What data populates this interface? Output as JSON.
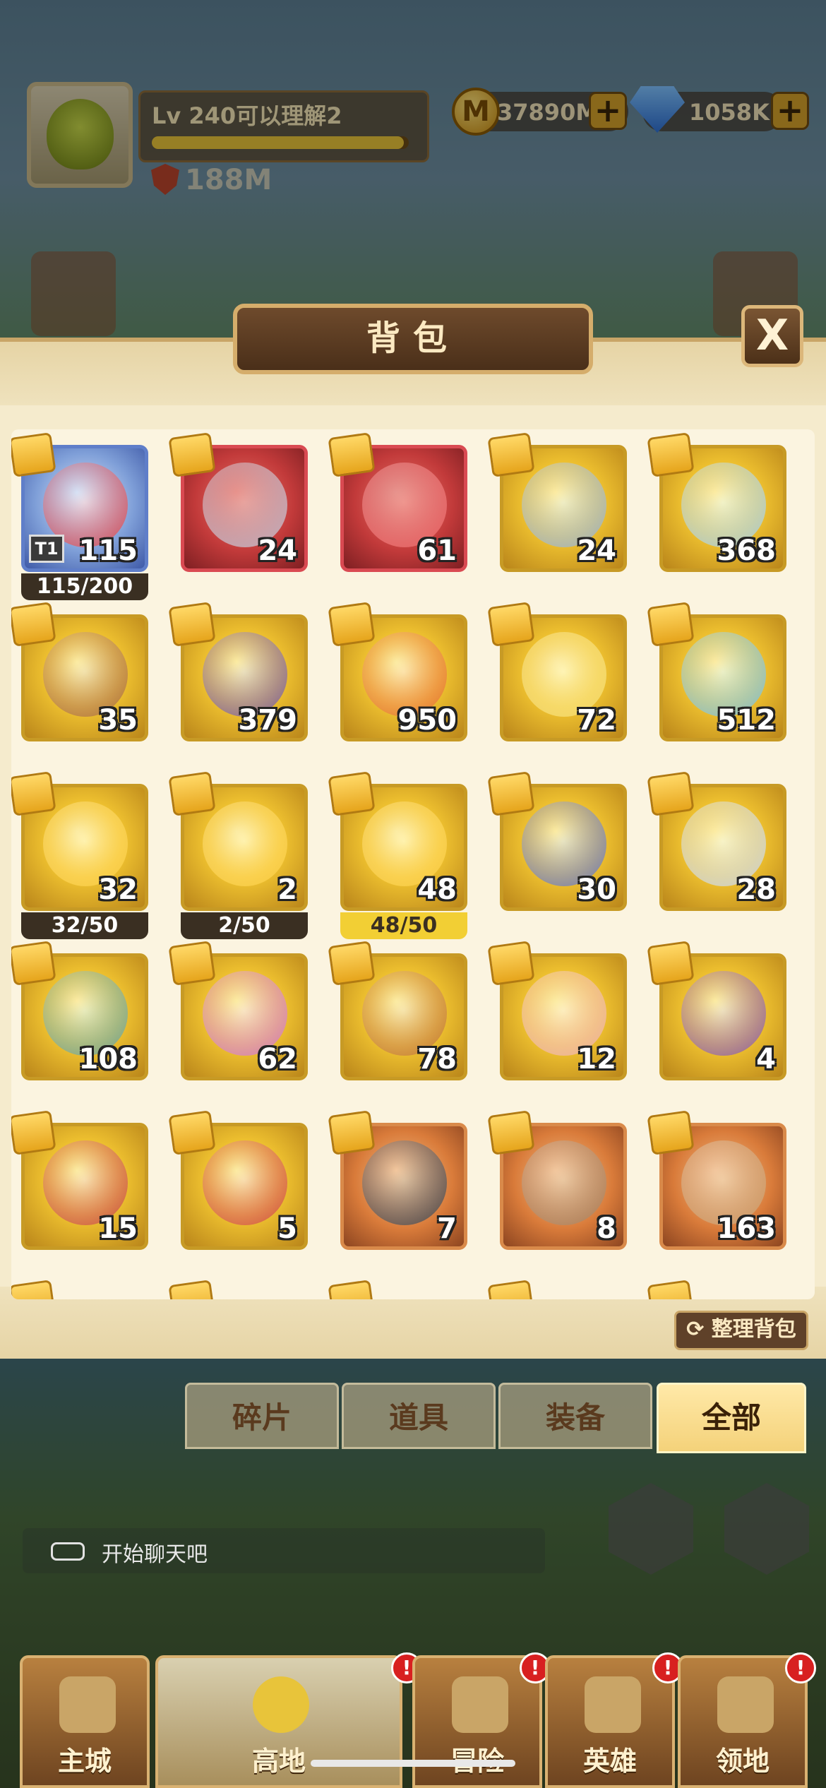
{
  "hud": {
    "player_name": "Lv 240可以理解2",
    "xp_fraction": 0.98,
    "power": "188M",
    "coin_symbol": "M",
    "coins": "37890M",
    "gems": "1058K",
    "plus": "+"
  },
  "panel": {
    "title": "背包",
    "close": "X",
    "sort_button": "整理背包"
  },
  "items": [
    {
      "count": "115",
      "frame": "blue",
      "tier": "T1",
      "progress": "115/200",
      "progress_style": "dark"
    },
    {
      "count": "24",
      "frame": "red"
    },
    {
      "count": "61",
      "frame": "red"
    },
    {
      "count": "24",
      "frame": "gold"
    },
    {
      "count": "368",
      "frame": "gold"
    },
    {
      "count": "35",
      "frame": "gold"
    },
    {
      "count": "379",
      "frame": "gold"
    },
    {
      "count": "950",
      "frame": "gold"
    },
    {
      "count": "72",
      "frame": "gold"
    },
    {
      "count": "512",
      "frame": "gold"
    },
    {
      "count": "32",
      "frame": "gold",
      "progress": "32/50",
      "progress_style": "dark"
    },
    {
      "count": "2",
      "frame": "gold",
      "progress": "2/50",
      "progress_style": "dark"
    },
    {
      "count": "48",
      "frame": "gold",
      "progress": "48/50",
      "progress_style": "yellow"
    },
    {
      "count": "30",
      "frame": "gold"
    },
    {
      "count": "28",
      "frame": "gold"
    },
    {
      "count": "108",
      "frame": "gold"
    },
    {
      "count": "62",
      "frame": "gold"
    },
    {
      "count": "78",
      "frame": "gold"
    },
    {
      "count": "12",
      "frame": "gold"
    },
    {
      "count": "4",
      "frame": "gold"
    },
    {
      "count": "15",
      "frame": "gold"
    },
    {
      "count": "5",
      "frame": "gold"
    },
    {
      "count": "7",
      "frame": "orange"
    },
    {
      "count": "8",
      "frame": "orange"
    },
    {
      "count": "163",
      "frame": "orange"
    }
  ],
  "tabs": [
    {
      "label": "碎片",
      "active": false
    },
    {
      "label": "道具",
      "active": false
    },
    {
      "label": "装备",
      "active": false
    },
    {
      "label": "全部",
      "active": true
    }
  ],
  "chat": {
    "placeholder": "开始聊天吧"
  },
  "nav": [
    {
      "label": "主城",
      "badge": ""
    },
    {
      "label": "高地",
      "badge": "!"
    },
    {
      "label": "冒险",
      "badge": "!"
    },
    {
      "label": "英雄",
      "badge": "!"
    },
    {
      "label": "领地",
      "badge": "!"
    }
  ],
  "colors": {
    "panel_bg": "#f5ebcd",
    "active_tab": "#f4d27a",
    "frame_gold": "#c79a25",
    "frame_red": "#d94a52",
    "frame_blue": "#5f7ec9",
    "frame_orange": "#d98a4a"
  }
}
